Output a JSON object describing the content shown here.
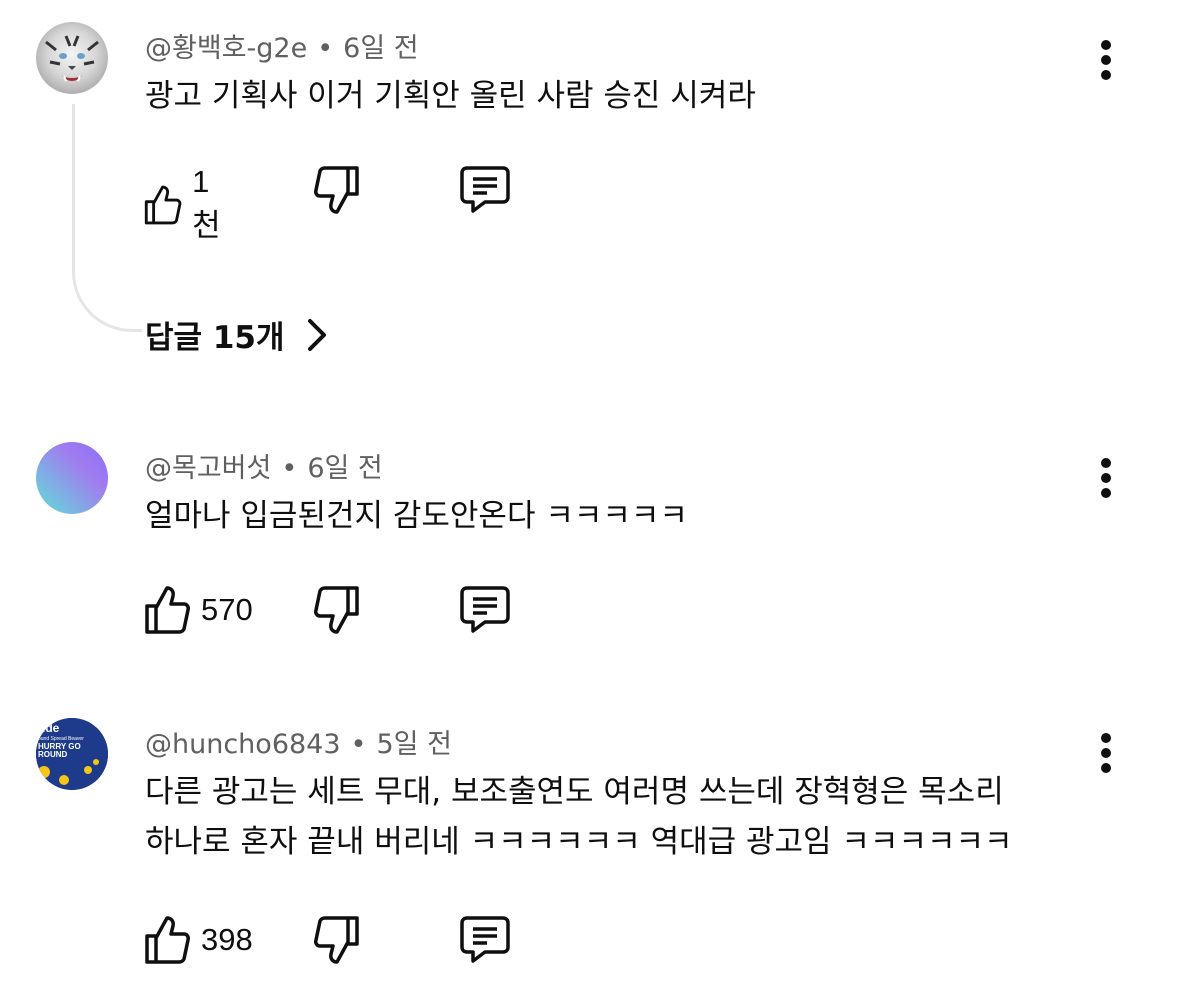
{
  "comments": [
    {
      "author": "@황백호-g2e",
      "separator": "•",
      "time": "6일 전",
      "lines": [
        "광고 기획사 이거 기획안 올린 사람 승진 시켜라"
      ],
      "likes": "1천",
      "replies_label": "답글 15개",
      "avatar": "white-tiger-avatar"
    },
    {
      "author": "@목고버섯",
      "separator": "•",
      "time": "6일 전",
      "lines": [
        "얼마나 입금된건지 감도안온다 ㅋㅋㅋㅋㅋ"
      ],
      "likes": "570",
      "avatar": "gradient-avatar",
      "avatar_colors": [
        "#8a6cf5",
        "#5fe0d8"
      ]
    },
    {
      "author": "@huncho6843",
      "separator": "•",
      "time": "5일 전",
      "lines": [
        "다른 광고는 세트 무대, 보조출연도 여러명 쓰는데 장혁형은 목소리",
        "하나로 혼자 끝내 버리네 ㅋㅋㅋㅋㅋㅋ 역대급 광고임 ㅋㅋㅋㅋㅋㅋ"
      ],
      "likes": "398",
      "avatar": "album-cover-avatar",
      "avatar_text": [
        "ude",
        "ound Spread Beaver",
        "HURRY GO",
        "ROUND"
      ],
      "avatar_colors": [
        "#1e3a8a",
        "#f5c518"
      ]
    }
  ],
  "icons": {
    "like": "thumbs-up-icon",
    "dislike": "thumbs-down-icon",
    "reply": "comment-icon",
    "more": "more-vertical-icon",
    "replies_arrow": "chevron-right-icon"
  },
  "colors": {
    "text": "#0f0f0f",
    "meta": "#606060",
    "thread_line": "#e5e5e5"
  }
}
